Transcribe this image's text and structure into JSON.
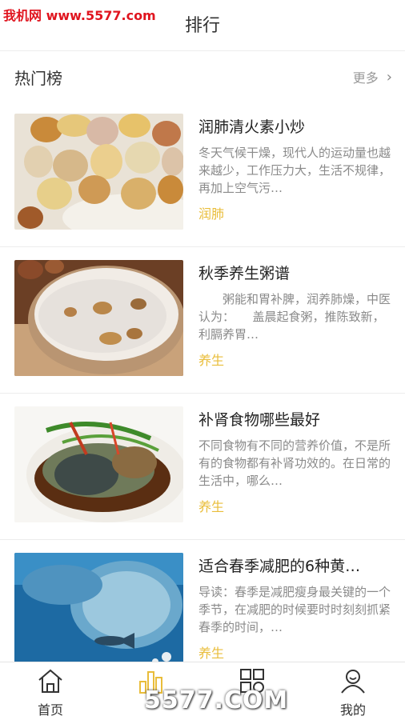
{
  "watermark": "我机网 www.5577.com",
  "header": {
    "title": "排行"
  },
  "section": {
    "title": "热门榜",
    "more": "更多"
  },
  "items": [
    {
      "title": "润肺清火素小炒",
      "desc": "冬天气候干燥，现代人的运动量也越来越少，工作压力大，生活不规律，再加上空气污…",
      "tag": "润肺"
    },
    {
      "title": "秋季养生粥谱",
      "desc": "　　粥能和胃补脾，润养肺燥，中医认为：　　盖晨起食粥，推陈致新，利膈养胃…",
      "tag": "养生"
    },
    {
      "title": "补肾食物哪些最好",
      "desc": "不同食物有不同的营养价值，不是所有的食物都有补肾功效的。在日常的生活中，哪么…",
      "tag": "养生"
    },
    {
      "title": "适合春季减肥的6种黄…",
      "desc": "导读：春季是减肥瘦身最关键的一个季节，在减肥的时候要时时刻刻抓紧春季的时间，…",
      "tag": "养生"
    }
  ],
  "tabs": [
    {
      "label": "首页",
      "icon": "home-icon"
    },
    {
      "label": "",
      "icon": "ranking-icon"
    },
    {
      "label": "",
      "icon": "category-grid-icon"
    },
    {
      "label": "我的",
      "icon": "profile-icon"
    }
  ],
  "bottom_watermark": "5577.COM",
  "colors": {
    "accent": "#e9bd3a",
    "brand_red": "#e0151f"
  }
}
